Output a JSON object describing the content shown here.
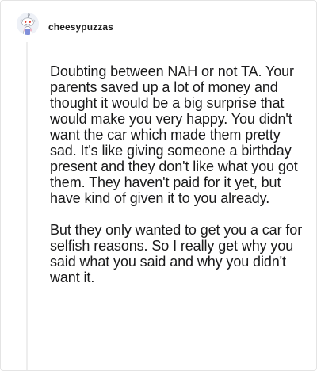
{
  "comment": {
    "author": "cheesypuzzas",
    "avatar_icon": "snoo-avatar-icon",
    "paragraphs": [
      "Doubting between NAH or not TA. Your parents saved up a lot of money and thought it would be a big surprise that would make you very happy. You didn't want the car which made them pretty sad. It's like giving someone a birthday present and they don't like what you got them. They haven't paid for it yet, but have kind of given it to you already.",
      "But they only wanted to get you a car for selfish reasons. So I really get why you said what you said and why you didn't want it."
    ]
  },
  "colors": {
    "text": "#1a1a1b",
    "border": "#e4e4e4",
    "thread_line": "#eeeeee"
  }
}
